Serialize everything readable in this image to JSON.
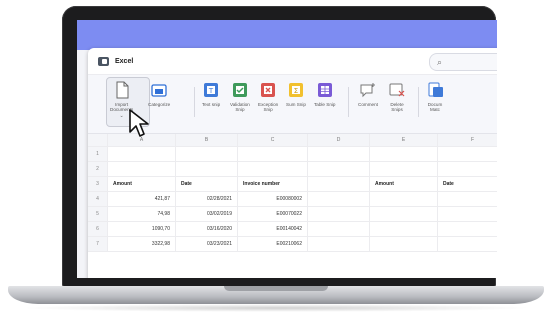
{
  "app": {
    "title": "Excel"
  },
  "toolbar": {
    "import_label": "Import\nDocuments",
    "categorize_label": "Categorize",
    "text_snip_label": "Text snip",
    "validation_snip_label": "Validation\nSnip",
    "exception_snip_label": "Exception\nSnip",
    "sum_snip_label": "Sum Snip",
    "table_snip_label": "Table Snip",
    "comment_label": "Comment",
    "delete_snips_label": "Delete\nSnips",
    "document_match_label": "Docum\nMatc"
  },
  "sheet": {
    "columns": [
      "A",
      "B",
      "C",
      "D",
      "E",
      "F"
    ],
    "row_numbers": [
      "1",
      "2",
      "3",
      "4",
      "5",
      "6",
      "7"
    ],
    "headers": {
      "a": "Amount",
      "b": "Date",
      "c": "Invoice number",
      "e": "Amount",
      "f": "Date"
    },
    "rows": [
      {
        "amount": "421,87",
        "date": "02/28/2021",
        "invoice": "E00080002"
      },
      {
        "amount": "74,98",
        "date": "03/02/2019",
        "invoice": "E00070022"
      },
      {
        "amount": "1090,70",
        "date": "03/16/2020",
        "invoice": "E00140042"
      },
      {
        "amount": "3322,98",
        "date": "03/23/2021",
        "invoice": "E00210062"
      }
    ]
  },
  "colors": {
    "accent": "#7d8cf2",
    "blue_icon": "#3f7ad8",
    "green_icon": "#3f9a5b",
    "red_icon": "#d9534f",
    "yellow_icon": "#f2c12e",
    "purple_icon": "#7a5bd6"
  }
}
